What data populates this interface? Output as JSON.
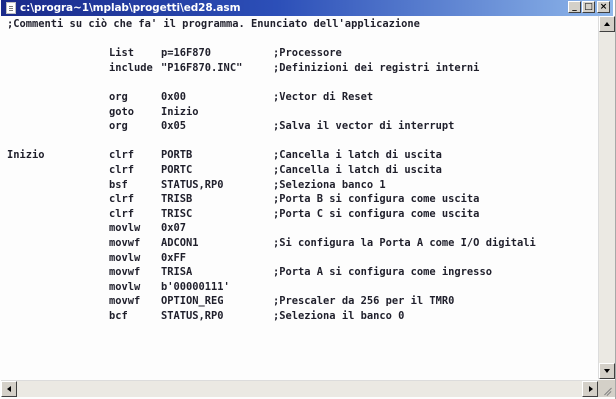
{
  "window": {
    "title": "c:\\progra~1\\mplab\\progetti\\ed28.asm",
    "controls": {
      "minimize": "_",
      "maximize": "□",
      "close": "×"
    }
  },
  "editor": {
    "lines": [
      {
        "label": "",
        "op": "",
        "arg": "",
        "comment": ";Commenti su ciò che fa' il programma. Enunciato dell'applicazione"
      },
      {
        "label": "",
        "op": "",
        "arg": "",
        "comment": ""
      },
      {
        "label": "",
        "op": "List",
        "arg": "p=16F870",
        "comment": ";Processore"
      },
      {
        "label": "",
        "op": "include",
        "arg": "\"P16F870.INC\"",
        "comment": ";Definizioni dei registri interni"
      },
      {
        "label": "",
        "op": "",
        "arg": "",
        "comment": ""
      },
      {
        "label": "",
        "op": "org",
        "arg": "0x00",
        "comment": ";Vector di Reset"
      },
      {
        "label": "",
        "op": "goto",
        "arg": "Inizio",
        "comment": ""
      },
      {
        "label": "",
        "op": "org",
        "arg": "0x05",
        "comment": ";Salva il vector di interrupt"
      },
      {
        "label": "",
        "op": "",
        "arg": "",
        "comment": ""
      },
      {
        "label": "Inizio",
        "op": "clrf",
        "arg": "PORTB",
        "comment": ";Cancella i latch di uscita"
      },
      {
        "label": "",
        "op": "clrf",
        "arg": "PORTC",
        "comment": ";Cancella i latch di uscita"
      },
      {
        "label": "",
        "op": "bsf",
        "arg": "STATUS,RP0",
        "comment": ";Seleziona banco 1"
      },
      {
        "label": "",
        "op": "clrf",
        "arg": "TRISB",
        "comment": ";Porta B si configura come uscita"
      },
      {
        "label": "",
        "op": "clrf",
        "arg": "TRISC",
        "comment": ";Porta C si configura come uscita"
      },
      {
        "label": "",
        "op": "movlw",
        "arg": "0x07",
        "comment": ""
      },
      {
        "label": "",
        "op": "movwf",
        "arg": "ADCON1",
        "comment": ";Si configura la Porta A come I/O digitali"
      },
      {
        "label": "",
        "op": "movlw",
        "arg": "0xFF",
        "comment": ""
      },
      {
        "label": "",
        "op": "movwf",
        "arg": "TRISA",
        "comment": ";Porta A si configura come ingresso"
      },
      {
        "label": "",
        "op": "movlw",
        "arg": "b'00000111'",
        "comment": ""
      },
      {
        "label": "",
        "op": "movwf",
        "arg": "OPTION_REG",
        "comment": ";Prescaler da 256 per il TMR0"
      },
      {
        "label": "",
        "op": "bcf",
        "arg": "STATUS,RP0",
        "comment": ";Seleziona il banco 0"
      }
    ]
  },
  "icons": {
    "title": "document-icon",
    "scroll_up": "arrow-up-icon",
    "scroll_down": "arrow-down-icon",
    "scroll_left": "arrow-left-icon",
    "scroll_right": "arrow-right-icon"
  },
  "colors": {
    "titlebar_start": "#1a2a8a",
    "titlebar_end": "#8fb7ea",
    "text": "#1f1f2b",
    "background": "#fdfdfd"
  }
}
